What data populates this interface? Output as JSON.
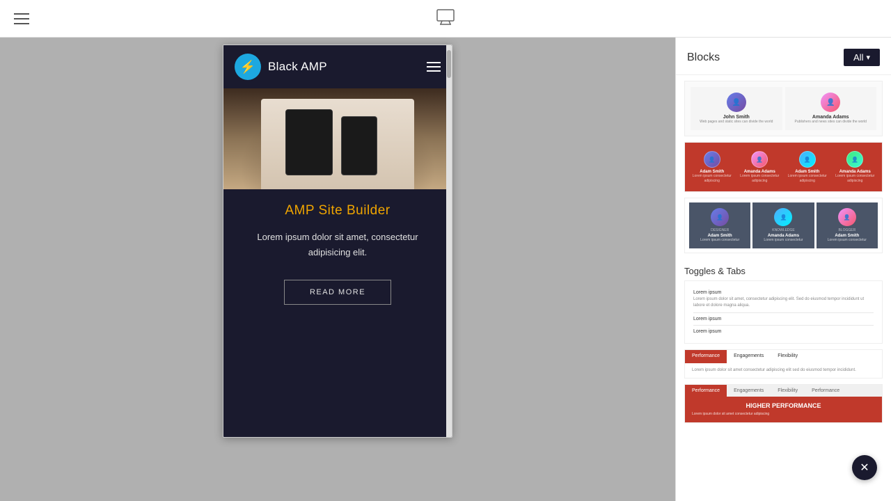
{
  "header": {
    "menu_label": "Menu",
    "monitor_label": "Desktop preview"
  },
  "canvas": {
    "mobile_nav": {
      "title": "Black AMP",
      "logo_icon": "⚡"
    },
    "hero": {
      "alt": "Phones on couch"
    },
    "content": {
      "title": "AMP Site Builder",
      "body": "Lorem ipsum dolor sit amet, consectetur adipisicing elit.",
      "cta": "READ MORE"
    }
  },
  "right_panel": {
    "title": "Blocks",
    "all_button": "All",
    "team_section": {
      "members_2col": [
        {
          "name": "John Smith",
          "desc": "Web pages and static sites can divide the world"
        },
        {
          "name": "Amanda Adams",
          "desc": "Publishers and news sites can divide the world"
        }
      ],
      "members_4col": [
        {
          "name": "Adam Smith",
          "desc": "Lorem ipsum consectetur adipiscing"
        },
        {
          "name": "Amanda Adams",
          "desc": "Lorem ipsum consectetur adipiscing"
        },
        {
          "name": "Adam Smith",
          "desc": "Lorem ipsum consectetur adipiscing"
        },
        {
          "name": "Amanda Adams",
          "desc": "Lorem ipsum consectetur adipiscing"
        }
      ],
      "members_3col": [
        {
          "name": "Adam Smith",
          "role": "DESIGNER",
          "desc": "Lorem ipsum consectetur"
        },
        {
          "name": "Amanda Adams",
          "role": "KNOWLEDGE",
          "desc": "Lorem ipsum consectetur"
        },
        {
          "name": "Adam Smith",
          "role": "BLOGGER",
          "desc": "Lorem ipsum consectetur"
        }
      ]
    },
    "toggles_section_label": "Toggles & Tabs",
    "toggles_items": [
      {
        "title": "Lorem ipsum",
        "content": "Lorem ipsum dolor sit amet, consectetur adipiscing elit. Sed do eiusmod tempor incididunt ut labore et dolore magna aliqua."
      },
      {
        "title": "Lorem ipsum",
        "content": ""
      },
      {
        "title": "Lorem ipsum",
        "content": ""
      }
    ],
    "tabs_block1": {
      "tabs": [
        "Performance",
        "Engagements",
        "Flexibility"
      ],
      "active_tab": 0,
      "content": "Lorem ipsum dolor sit amet consectetur adipiscing elit sed do eiusmod tempor incididunt."
    },
    "tabs_block2": {
      "tabs": [
        "Performance",
        "Engagements",
        "Flexibility",
        "Performance"
      ],
      "active_tab": 0,
      "heading": "HIGHER PERFORMANCE",
      "content": "Lorem ipsum dolor sit amet consectetur adipiscing"
    }
  }
}
